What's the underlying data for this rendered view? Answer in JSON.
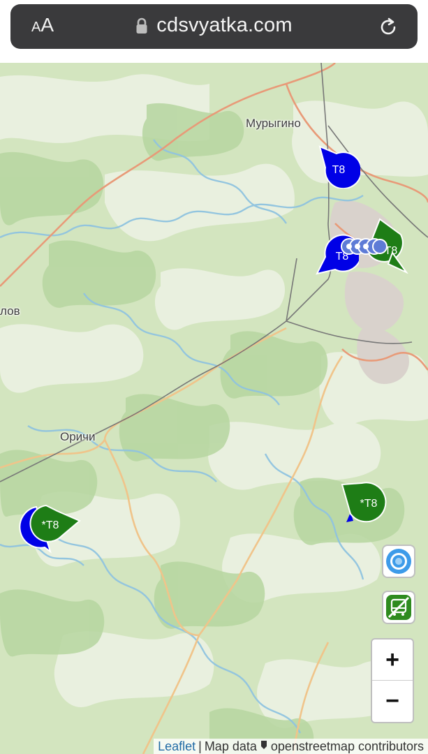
{
  "browser": {
    "text_size_small": "A",
    "text_size_big": "A",
    "url": "cdsvyatka.com"
  },
  "map": {
    "labels": {
      "murygino": "Мурыгино",
      "orichi": "Оричи",
      "lov": "лов"
    },
    "markers": [
      {
        "id": "m1",
        "text": "T8",
        "color": "#0000e6",
        "tail": "up-left"
      },
      {
        "id": "m2",
        "text": "T8",
        "color": "#0000e6",
        "tail": "down-left"
      },
      {
        "id": "m3",
        "text": "T8",
        "color": "#1e7d16",
        "tail": "up-right"
      },
      {
        "id": "m4",
        "text": "*T8",
        "color": "#1e7d16",
        "tail": "right"
      },
      {
        "id": "m5",
        "text": "*T8",
        "color": "#1e7d16",
        "tail": "down-left"
      }
    ],
    "controls": {
      "zoom_in": "+",
      "zoom_out": "−"
    },
    "attribution": {
      "leaflet": "Leaflet",
      "separator": "|",
      "map_data": "Map data",
      "osm": "openstreetmap contributors"
    }
  },
  "colors": {
    "bus_blue": "#0000e6",
    "bus_green": "#1e7d16",
    "locate_blue": "#2f8fe0"
  }
}
